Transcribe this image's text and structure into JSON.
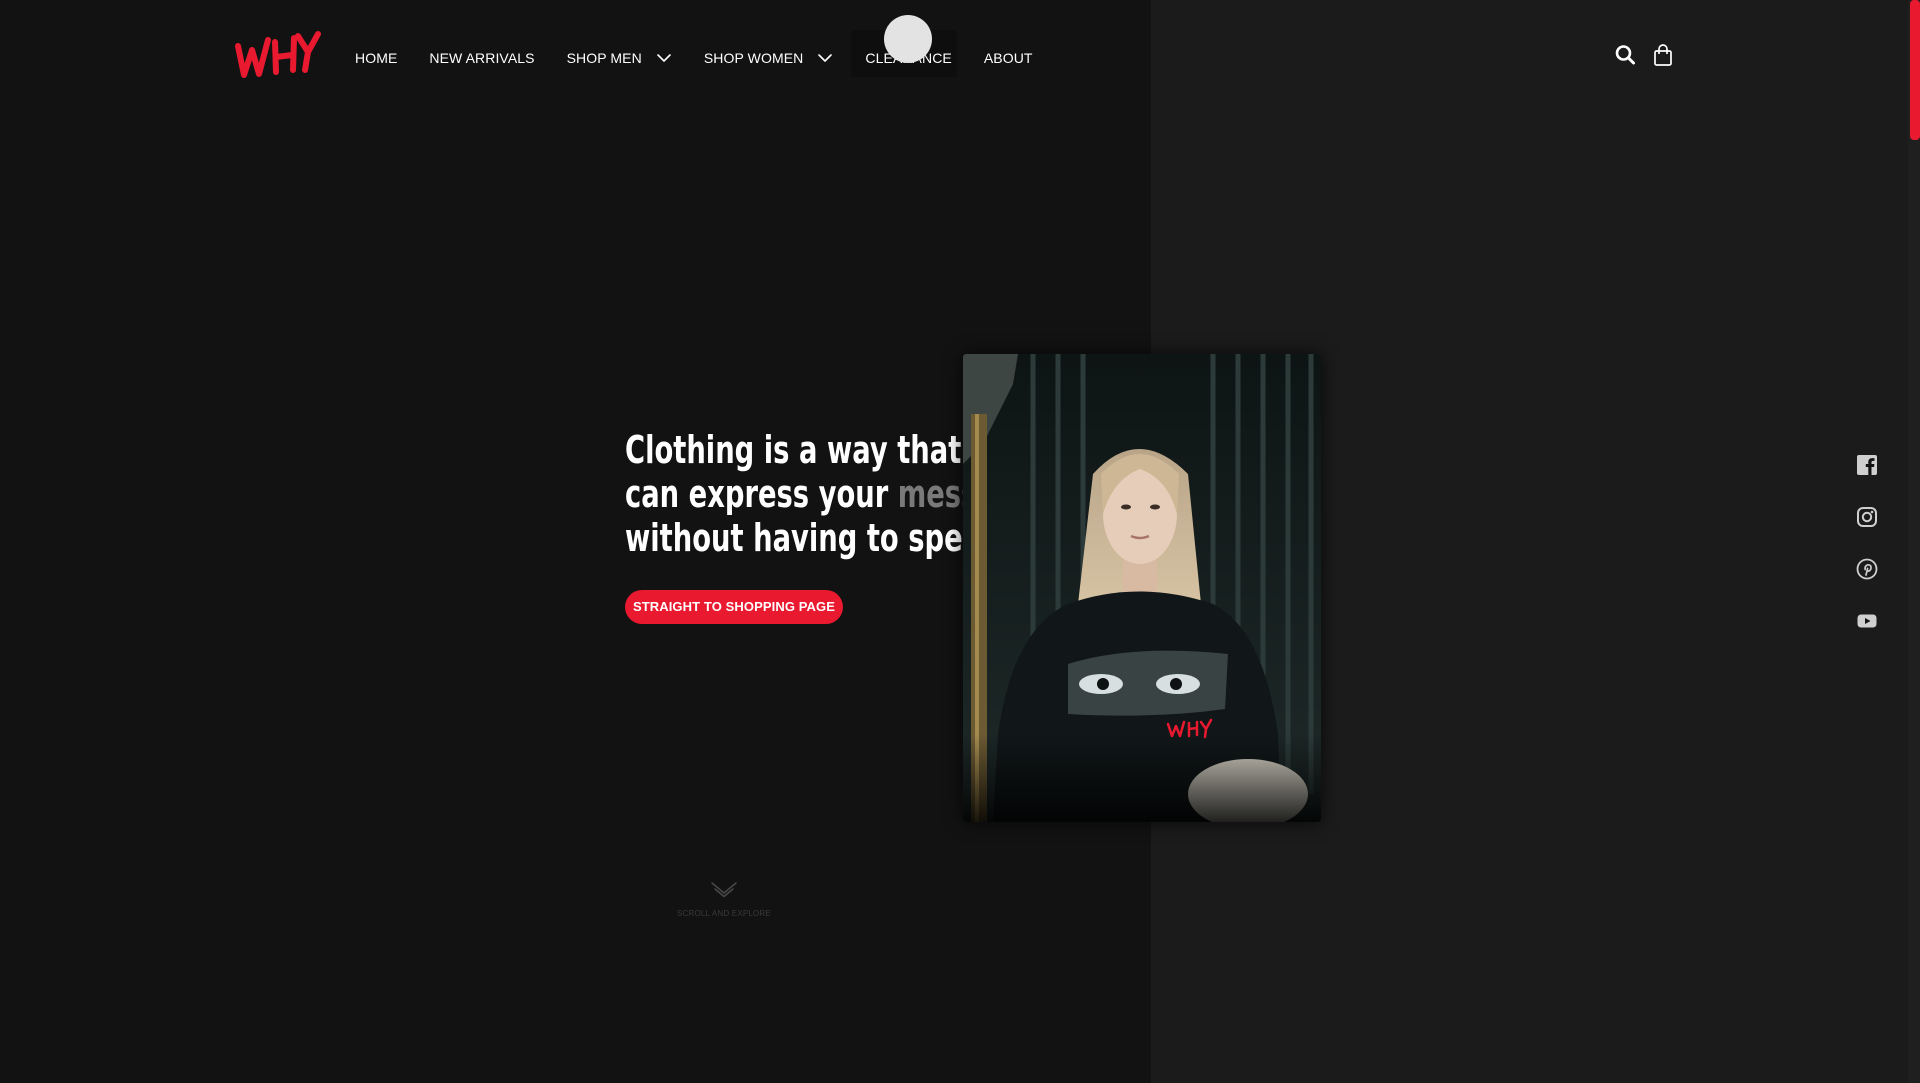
{
  "brand": {
    "logo_text": "WHY",
    "accent_color": "#e9192f"
  },
  "nav": {
    "items": [
      {
        "label": "HOME",
        "has_dropdown": false
      },
      {
        "label": "NEW ARRIVALS",
        "has_dropdown": false
      },
      {
        "label": "SHOP MEN",
        "has_dropdown": true
      },
      {
        "label": "SHOP WOMEN",
        "has_dropdown": true
      },
      {
        "label": "CLEARANCE",
        "has_dropdown": false,
        "hovered": true
      },
      {
        "label": "ABOUT",
        "has_dropdown": false
      }
    ]
  },
  "header_icons": [
    "search-icon",
    "shopping-bag-icon"
  ],
  "hero": {
    "line1": "Clothing is a way that y",
    "line2_prefix": "can express your ",
    "line2_muted": "messa",
    "line3": "without having to speak",
    "cta_label": "STRAIGHT TO SHOPPING PAGE"
  },
  "social_icons": [
    "facebook-icon",
    "instagram-icon",
    "pinterest-icon",
    "youtube-icon"
  ],
  "scroll_hint": {
    "label": "SCROLL AND EXPLORE"
  },
  "colors": {
    "background_left": "#121212",
    "background_right": "#1b1b1b",
    "cursor": "#e3e3e3"
  }
}
